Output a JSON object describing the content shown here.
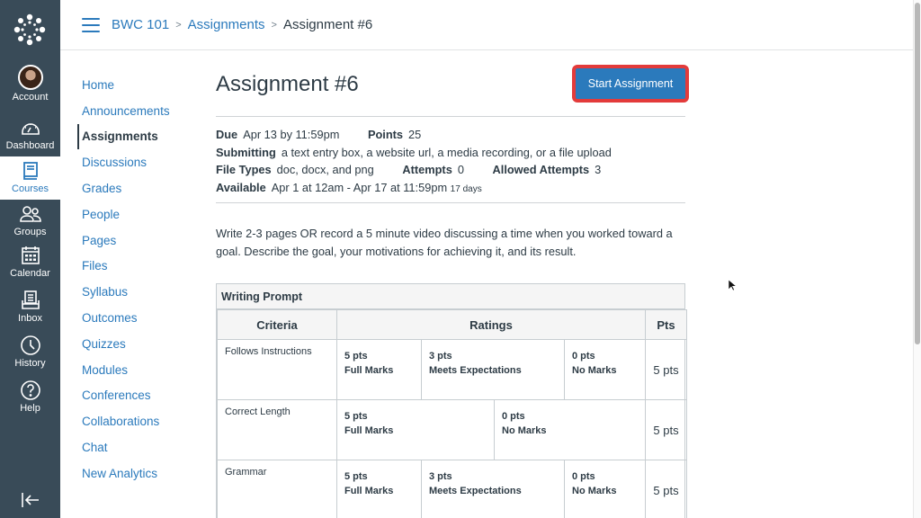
{
  "global_nav": {
    "items": [
      {
        "key": "account",
        "label": "Account",
        "icon": "avatar"
      },
      {
        "key": "dashboard",
        "label": "Dashboard",
        "icon": "dashboard-icon"
      },
      {
        "key": "courses",
        "label": "Courses",
        "icon": "book-icon",
        "active": true
      },
      {
        "key": "groups",
        "label": "Groups",
        "icon": "groups-icon"
      },
      {
        "key": "calendar",
        "label": "Calendar",
        "icon": "calendar-icon"
      },
      {
        "key": "inbox",
        "label": "Inbox",
        "icon": "inbox-icon"
      },
      {
        "key": "history",
        "label": "History",
        "icon": "clock-icon"
      },
      {
        "key": "help",
        "label": "Help",
        "icon": "help-icon"
      }
    ],
    "collapse_icon": "collapse-nav-icon"
  },
  "breadcrumb": {
    "items": [
      "BWC 101",
      "Assignments"
    ],
    "separator": ">",
    "current": "Assignment #6"
  },
  "course_nav": {
    "items": [
      {
        "label": "Home"
      },
      {
        "label": "Announcements"
      },
      {
        "label": "Assignments",
        "active": true
      },
      {
        "label": "Discussions"
      },
      {
        "label": "Grades"
      },
      {
        "label": "People"
      },
      {
        "label": "Pages"
      },
      {
        "label": "Files"
      },
      {
        "label": "Syllabus"
      },
      {
        "label": "Outcomes"
      },
      {
        "label": "Quizzes"
      },
      {
        "label": "Modules"
      },
      {
        "label": "Conferences"
      },
      {
        "label": "Collaborations"
      },
      {
        "label": "Chat"
      },
      {
        "label": "New Analytics"
      }
    ]
  },
  "assignment": {
    "title": "Assignment #6",
    "start_button": "Start Assignment",
    "details": {
      "due_label": "Due",
      "due_value": "Apr 13 by 11:59pm",
      "points_label": "Points",
      "points_value": "25",
      "submitting_label": "Submitting",
      "submitting_value": "a text entry box, a website url, a media recording, or a file upload",
      "file_types_label": "File Types",
      "file_types_value": "doc, docx, and png",
      "attempts_label": "Attempts",
      "attempts_value": "0",
      "allowed_attempts_label": "Allowed Attempts",
      "allowed_attempts_value": "3",
      "available_label": "Available",
      "available_value": "Apr 1 at 12am - Apr 17 at 11:59pm",
      "available_days": "17 days"
    },
    "description": "Write 2-3 pages OR record a 5 minute video discussing a time when you worked toward a goal. Describe the goal, your motivations for achieving it, and its result."
  },
  "rubric": {
    "title": "Writing Prompt",
    "headers": {
      "criteria": "Criteria",
      "ratings": "Ratings",
      "pts": "Pts"
    },
    "rows": [
      {
        "criterion": "Follows Instructions",
        "ratings": [
          {
            "points": "5 pts",
            "label": "Full Marks"
          },
          {
            "points": "3 pts",
            "label": "Meets Expectations"
          },
          {
            "points": "0 pts",
            "label": "No Marks"
          }
        ],
        "pts": "5 pts"
      },
      {
        "criterion": "Correct Length",
        "ratings": [
          {
            "points": "5 pts",
            "label": "Full Marks"
          },
          {
            "points": "0 pts",
            "label": "No Marks"
          }
        ],
        "pts": "5 pts"
      },
      {
        "criterion": "Grammar",
        "ratings": [
          {
            "points": "5 pts",
            "label": "Full Marks"
          },
          {
            "points": "3 pts",
            "label": "Meets Expectations"
          },
          {
            "points": "0 pts",
            "label": "No Marks"
          }
        ],
        "pts": "5 pts"
      }
    ]
  },
  "colors": {
    "link": "#2b7abc",
    "nav_bg": "#394b58",
    "button_bg": "#2b7abc",
    "highlight": "#e33b3b"
  }
}
